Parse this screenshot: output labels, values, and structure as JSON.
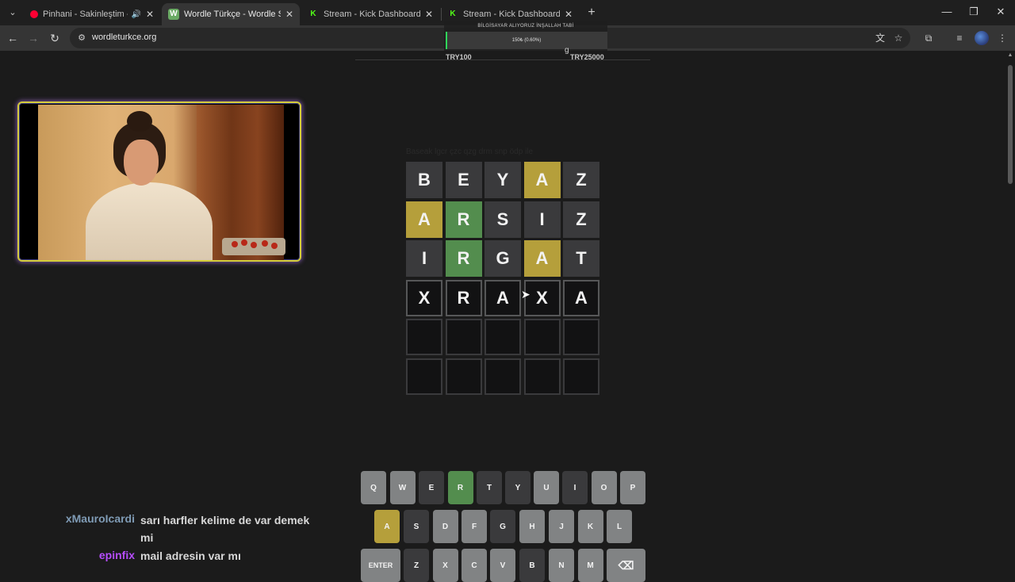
{
  "browser": {
    "tabs": [
      {
        "title": "Pinhani - Sakinleştim - YouTube",
        "favicon": "youtube-icon",
        "fav_color": "#ff0033",
        "active": false
      },
      {
        "title": "Wordle Türkçe - Wordle Sınırsız",
        "favicon": "W",
        "fav_color": "#6aaa64",
        "active": true
      },
      {
        "title": "Stream - Kick Dashboard",
        "favicon": "K",
        "fav_color": "#53fc18",
        "active": false
      },
      {
        "title": "Stream - Kick Dashboard",
        "favicon": "K",
        "fav_color": "#53fc18",
        "active": false
      }
    ],
    "url": "wordleturkce.org"
  },
  "donation_goal": {
    "title": "BİLGİSAYAR ALIYORUZ İNŞALLAH TABİ",
    "amount": "150₺ (0.60%)",
    "progress": 0.006,
    "min_label": "TRY100",
    "max_label": "TRY25000"
  },
  "wordle": {
    "hint": "Baseak lgcr çzc qzg drm snp ödp ile",
    "rows": [
      {
        "letters": [
          "B",
          "E",
          "Y",
          "A",
          "Z"
        ],
        "states": [
          "absent",
          "absent",
          "absent",
          "present",
          "absent"
        ]
      },
      {
        "letters": [
          "A",
          "R",
          "S",
          "I",
          "Z"
        ],
        "states": [
          "present",
          "correct",
          "absent",
          "absent",
          "absent"
        ]
      },
      {
        "letters": [
          "I",
          "R",
          "G",
          "A",
          "T"
        ],
        "states": [
          "absent",
          "correct",
          "absent",
          "present",
          "absent"
        ]
      },
      {
        "letters": [
          "X",
          "R",
          "A",
          "X",
          "A"
        ],
        "states": [
          "tbd",
          "tbd",
          "tbd",
          "tbd",
          "tbd"
        ]
      },
      {
        "letters": [
          "",
          "",
          "",
          "",
          ""
        ],
        "states": [
          "empty",
          "empty",
          "empty",
          "empty",
          "empty"
        ]
      },
      {
        "letters": [
          "",
          "",
          "",
          "",
          ""
        ],
        "states": [
          "empty",
          "empty",
          "empty",
          "empty",
          "empty"
        ]
      }
    ]
  },
  "keyboard": {
    "rows": [
      [
        {
          "k": "Q",
          "s": "unused"
        },
        {
          "k": "W",
          "s": "unused"
        },
        {
          "k": "E",
          "s": "absent"
        },
        {
          "k": "R",
          "s": "correct"
        },
        {
          "k": "T",
          "s": "absent"
        },
        {
          "k": "Y",
          "s": "absent"
        },
        {
          "k": "U",
          "s": "unused"
        },
        {
          "k": "I",
          "s": "absent"
        },
        {
          "k": "O",
          "s": "unused"
        },
        {
          "k": "P",
          "s": "unused"
        }
      ],
      [
        {
          "k": "A",
          "s": "present"
        },
        {
          "k": "S",
          "s": "absent"
        },
        {
          "k": "D",
          "s": "unused"
        },
        {
          "k": "F",
          "s": "unused"
        },
        {
          "k": "G",
          "s": "absent"
        },
        {
          "k": "H",
          "s": "unused"
        },
        {
          "k": "J",
          "s": "unused"
        },
        {
          "k": "K",
          "s": "unused"
        },
        {
          "k": "L",
          "s": "unused"
        }
      ],
      [
        {
          "k": "ENTER",
          "s": "unused"
        },
        {
          "k": "Z",
          "s": "absent"
        },
        {
          "k": "X",
          "s": "unused"
        },
        {
          "k": "C",
          "s": "unused"
        },
        {
          "k": "V",
          "s": "unused"
        },
        {
          "k": "B",
          "s": "absent"
        },
        {
          "k": "N",
          "s": "unused"
        },
        {
          "k": "M",
          "s": "unused"
        },
        {
          "k": "⌫",
          "s": "unused"
        }
      ]
    ]
  },
  "chat": [
    {
      "user": "xMauroIcardi",
      "user_color": "#7f9bb5",
      "message": "sarı harfler kelime de var demek mi"
    },
    {
      "user": "epinfix",
      "user_color": "#b64dff",
      "message": "mail adresin var mı"
    }
  ],
  "colors": {
    "correct": "#538d4e",
    "present": "#b59f3b",
    "absent": "#3a3a3c",
    "unused": "#818384"
  }
}
